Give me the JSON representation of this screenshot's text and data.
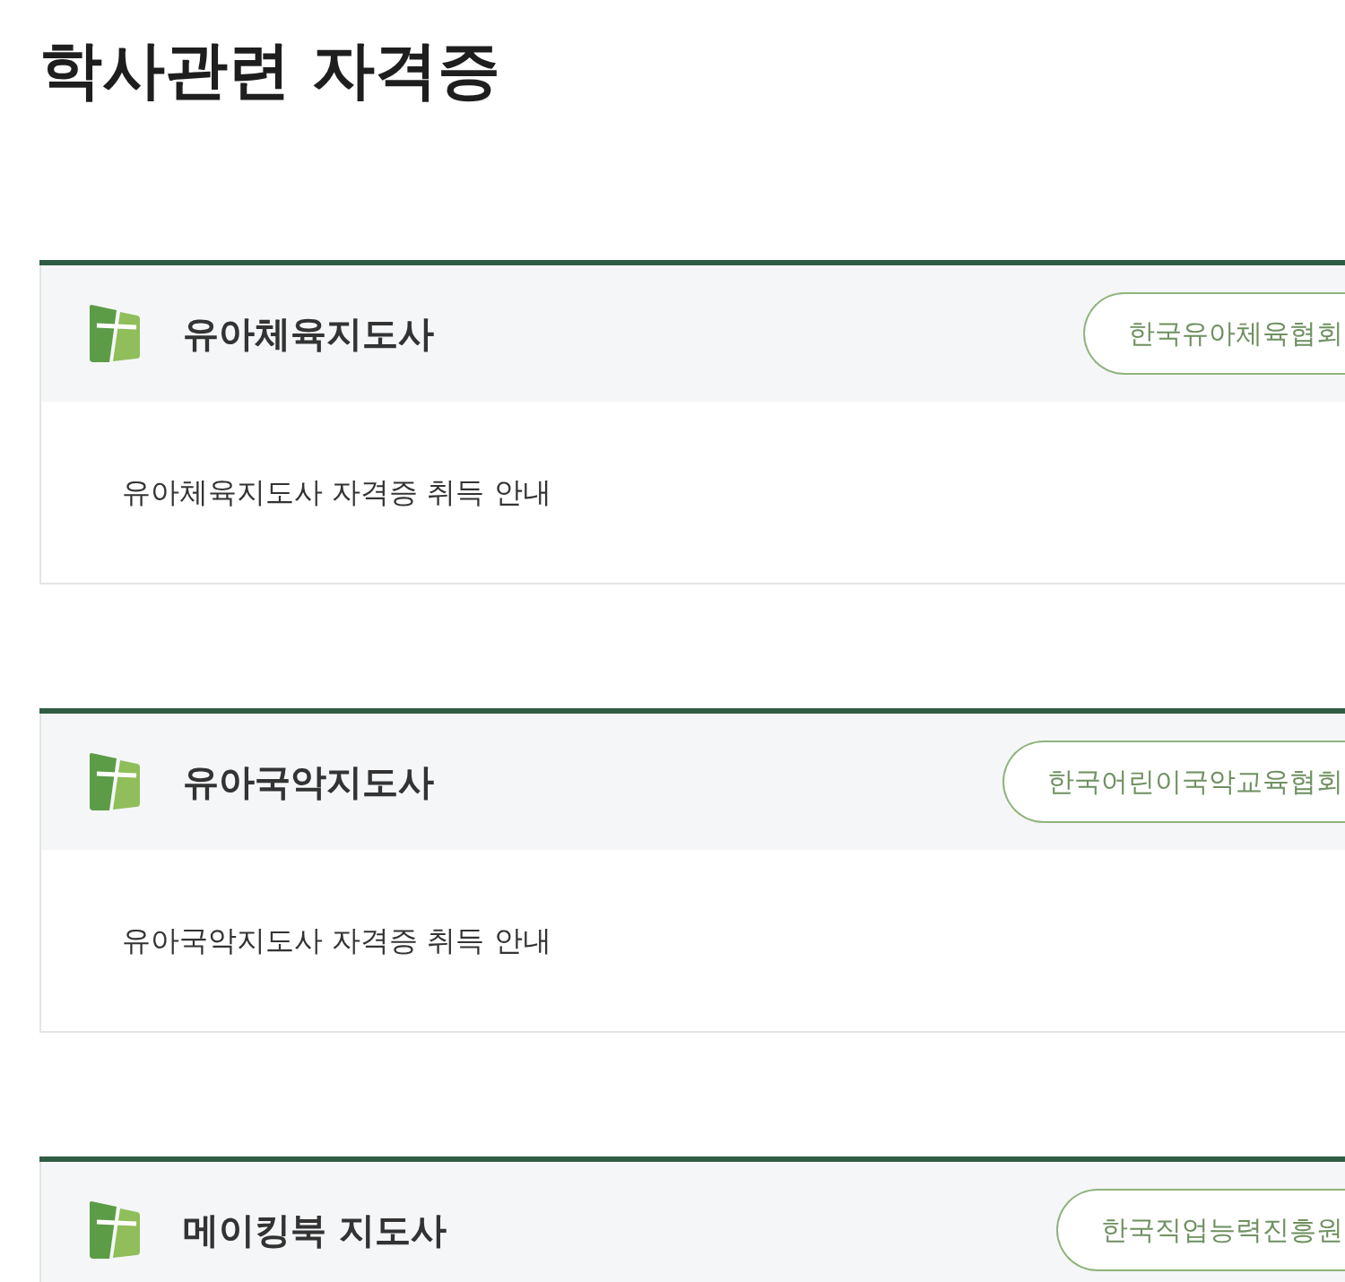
{
  "page": {
    "title": "학사관련 자격증"
  },
  "certificates": [
    {
      "name": "유아체육지도사",
      "issuer": "한국유아체육협회",
      "description": "유아체육지도사 자격증 취득 안내"
    },
    {
      "name": "유아국악지도사",
      "issuer": "한국어린이국악교육협회",
      "description": "유아국악지도사 자격증 취득 안내"
    },
    {
      "name": "메이킹북 지도사",
      "issuer": "한국직업능력진흥원"
    }
  ]
}
